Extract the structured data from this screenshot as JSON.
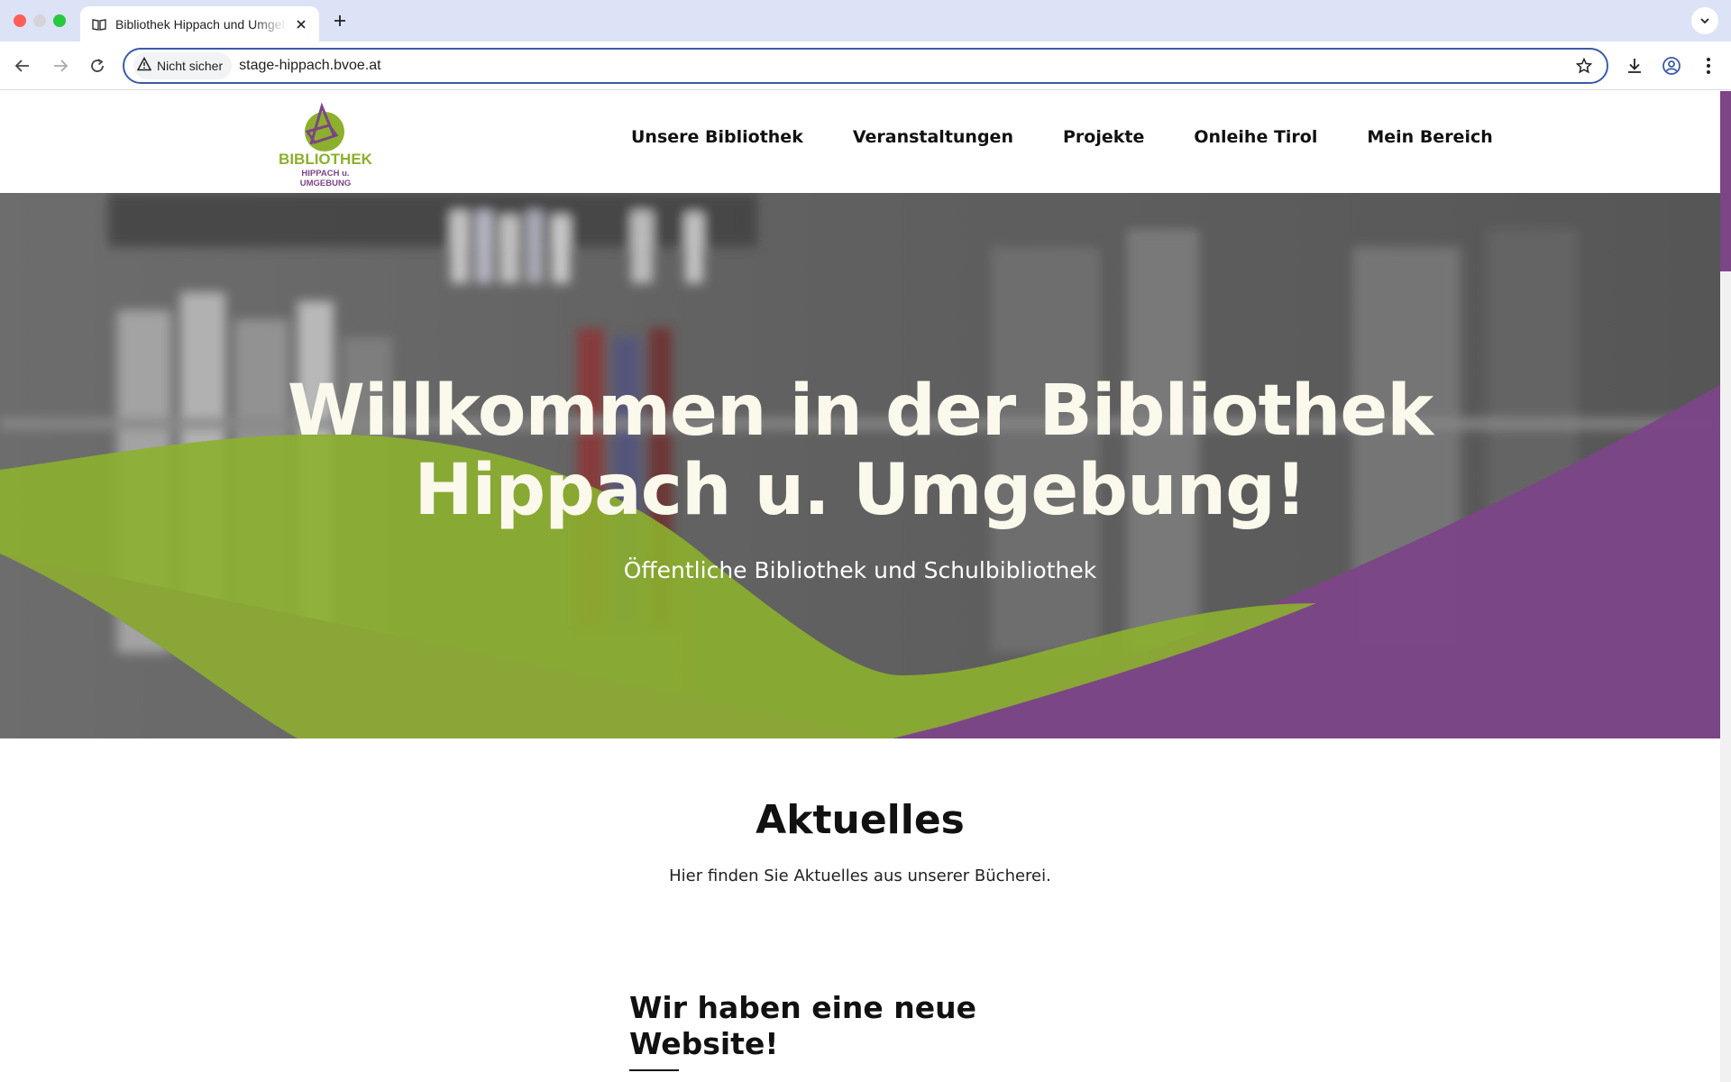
{
  "browser": {
    "tab_title": "Bibliothek Hippach und Umgebung",
    "security_label": "Nicht sicher",
    "url": "stage-hippach.bvoe.at"
  },
  "site": {
    "logo": {
      "line1": "BIBLIOTHEK",
      "line2": "HIPPACH u. UMGEBUNG"
    },
    "nav": [
      "Unsere Bibliothek",
      "Veranstaltungen",
      "Projekte",
      "Onleihe Tirol",
      "Mein Bereich"
    ],
    "hero": {
      "title_line1": "Willkommen in der Bibliothek",
      "title_line2": "Hippach u. Umgebung!",
      "subtitle": "Öffentliche Bibliothek und Schulbibliothek"
    },
    "news": {
      "heading": "Aktuelles",
      "intro": "Hier finden Sie Aktuelles aus unserer Bücherei.",
      "post_title": "Wir haben eine neue Website!"
    },
    "colors": {
      "purple": "#7c4586",
      "green": "#8cb02e",
      "hero_text": "#fbf8ec"
    }
  }
}
